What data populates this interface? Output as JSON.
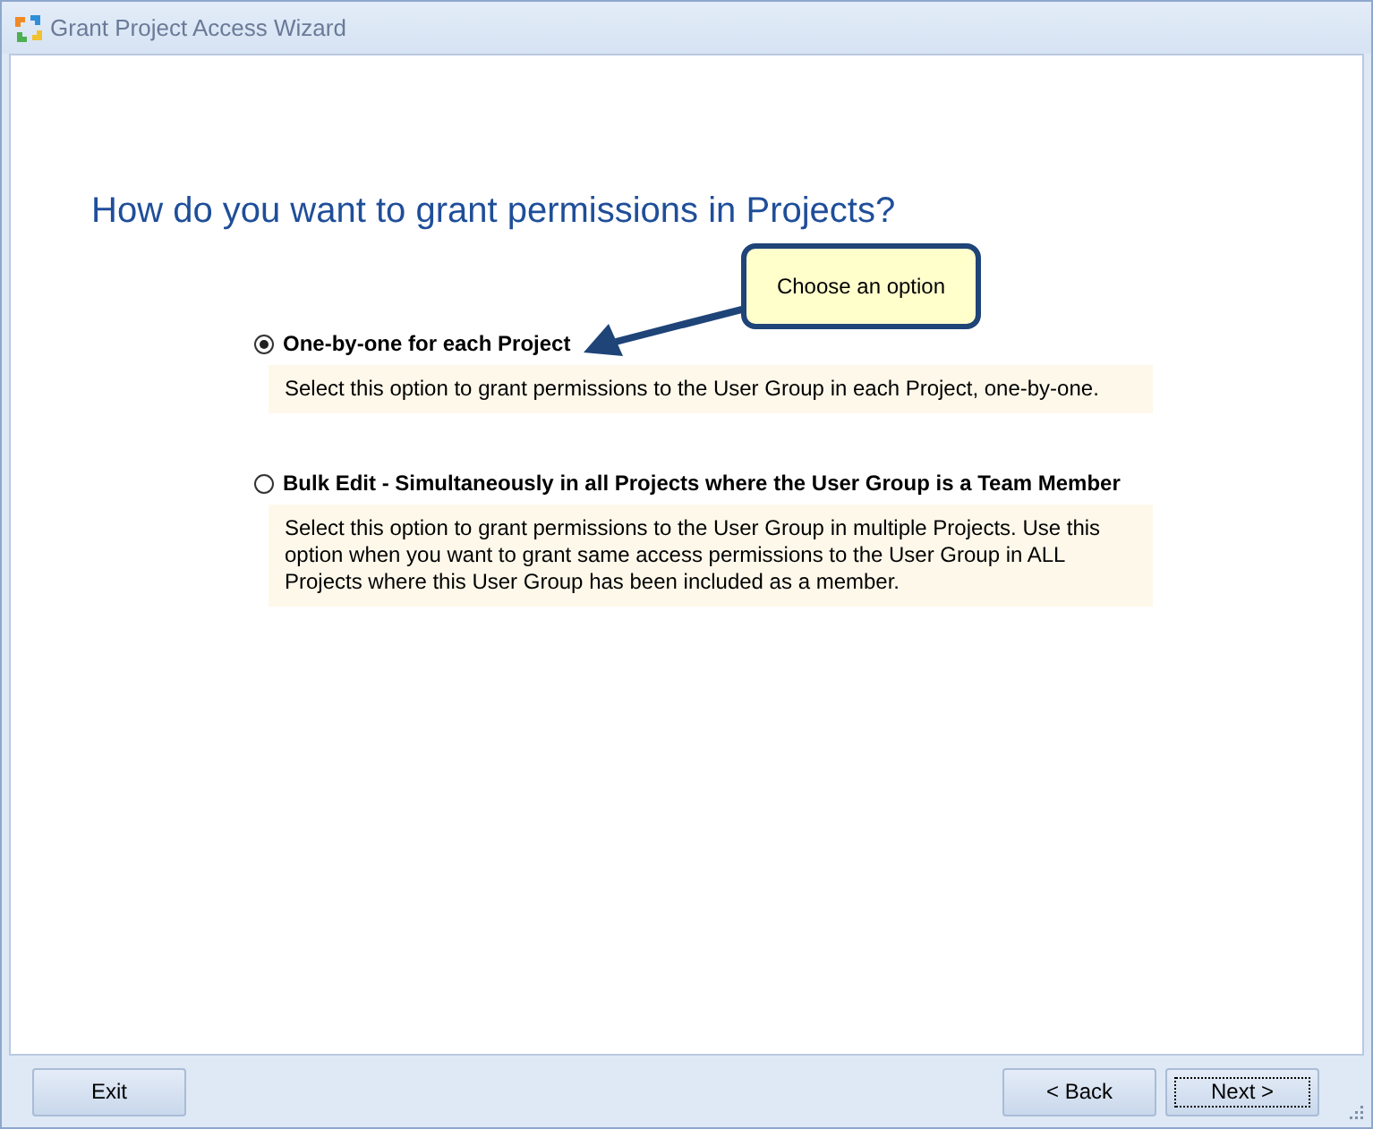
{
  "window": {
    "title": "Grant Project Access Wizard"
  },
  "heading": "How do you want to grant permissions in Projects?",
  "callout": "Choose an option",
  "options": [
    {
      "label": "One-by-one for each Project",
      "selected": true,
      "description": "Select this option to grant permissions to the User Group in each Project, one-by-one."
    },
    {
      "label": "Bulk Edit - Simultaneously in all Projects where the User Group is a Team Member",
      "selected": false,
      "description": "Select this option to grant permissions to the User Group in multiple Projects. Use this option when you want to grant same access permissions to the User Group in ALL Projects where this User Group has been included as a member."
    }
  ],
  "buttons": [
    {
      "label": "Exit",
      "focused": false
    },
    {
      "label": "< Back",
      "focused": false
    },
    {
      "label": "Next >",
      "focused": true
    }
  ]
}
